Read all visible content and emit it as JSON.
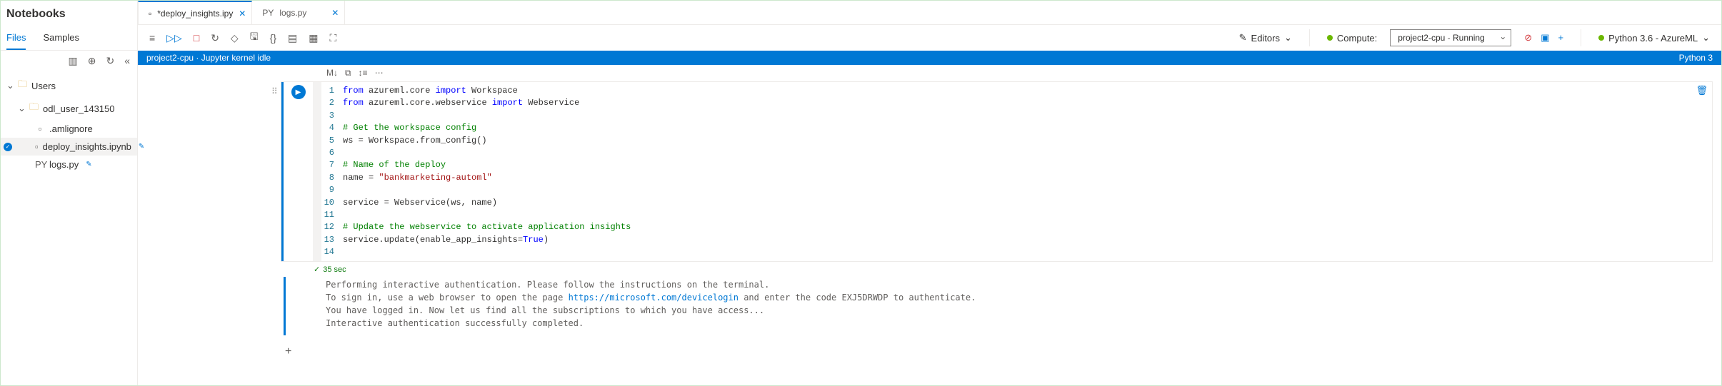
{
  "sidebar": {
    "title": "Notebooks",
    "tabs": [
      "Files",
      "Samples"
    ],
    "active_tab": 0,
    "tree": {
      "root": "Users",
      "user": "odl_user_143150",
      "files": [
        {
          "name": ".amlignore",
          "type": "PY",
          "icon": "▢"
        },
        {
          "name": "deploy_insights.ipynb",
          "type": "PY",
          "selected": true,
          "edited": true,
          "icon": "▢"
        },
        {
          "name": "logs.py",
          "type": "PY",
          "edited": true
        }
      ]
    }
  },
  "tabs": [
    {
      "label": "*deploy_insights.ipy",
      "icon": "▢",
      "active": true
    },
    {
      "label": "logs.py",
      "prefix": "PY",
      "active": false
    }
  ],
  "toolbar": {
    "editors_label": "Editors",
    "compute_label": "Compute:",
    "compute_selected": "project2-cpu",
    "compute_status": "Running",
    "kernel": "Python 3.6 - AzureML"
  },
  "status": {
    "left": "project2-cpu · Jupyter kernel idle",
    "right": "Python 3"
  },
  "cell_tools": [
    "M↓",
    "⧉",
    "↕≡",
    "⋯"
  ],
  "code_lines": [
    {
      "n": 1,
      "html": "<span class='kw'>from</span> azureml.core <span class='kw'>import</span> Workspace"
    },
    {
      "n": 2,
      "html": "<span class='kw'>from</span> azureml.core.webservice <span class='kw'>import</span> Webservice"
    },
    {
      "n": 3,
      "html": ""
    },
    {
      "n": 4,
      "html": "<span class='cm'># Get the workspace config</span>"
    },
    {
      "n": 5,
      "html": "ws = Workspace.from_config()"
    },
    {
      "n": 6,
      "html": ""
    },
    {
      "n": 7,
      "html": "<span class='cm'># Name of the deploy</span>"
    },
    {
      "n": 8,
      "html": "name = <span class='st'>\"bankmarketing-automl\"</span>"
    },
    {
      "n": 9,
      "html": ""
    },
    {
      "n": 10,
      "html": "service = Webservice(ws, name)"
    },
    {
      "n": 11,
      "html": ""
    },
    {
      "n": 12,
      "html": "<span class='cm'># Update the webservice to activate application insights</span>"
    },
    {
      "n": 13,
      "html": "service.update(enable_app_insights=<span class='bool'>True</span>)"
    },
    {
      "n": 14,
      "html": ""
    }
  ],
  "exec": {
    "status": "✓",
    "time": "35 sec"
  },
  "output": {
    "line1": "Performing interactive authentication. Please follow the instructions on the terminal.",
    "line2a": "To sign in, use a web browser to open the page ",
    "link": "https://microsoft.com/devicelogin",
    "line2b": " and enter the code EXJ5DRWDP to authenticate.",
    "line3": "You have logged in. Now let us find all the subscriptions to which you have access...",
    "line4": "Interactive authentication successfully completed."
  }
}
